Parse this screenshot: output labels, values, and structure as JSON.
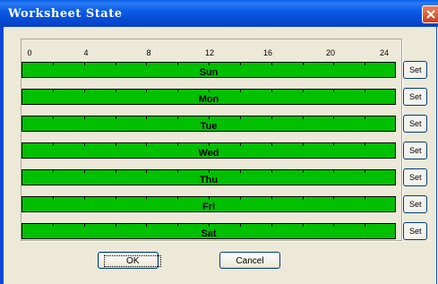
{
  "window": {
    "title": "Worksheet State",
    "close_icon": "close-icon"
  },
  "hour_labels": [
    "0",
    "4",
    "8",
    "12",
    "16",
    "20",
    "24"
  ],
  "days": [
    {
      "label": "Sun",
      "color": "#00c000"
    },
    {
      "label": "Mon",
      "color": "#00c000"
    },
    {
      "label": "Tue",
      "color": "#00c000"
    },
    {
      "label": "Wed",
      "color": "#00c000"
    },
    {
      "label": "Thu",
      "color": "#00c000"
    },
    {
      "label": "Fri",
      "color": "#00c000"
    },
    {
      "label": "Sat",
      "color": "#00c000"
    }
  ],
  "set_label": "Set",
  "buttons": {
    "ok": "OK",
    "cancel": "Cancel"
  }
}
